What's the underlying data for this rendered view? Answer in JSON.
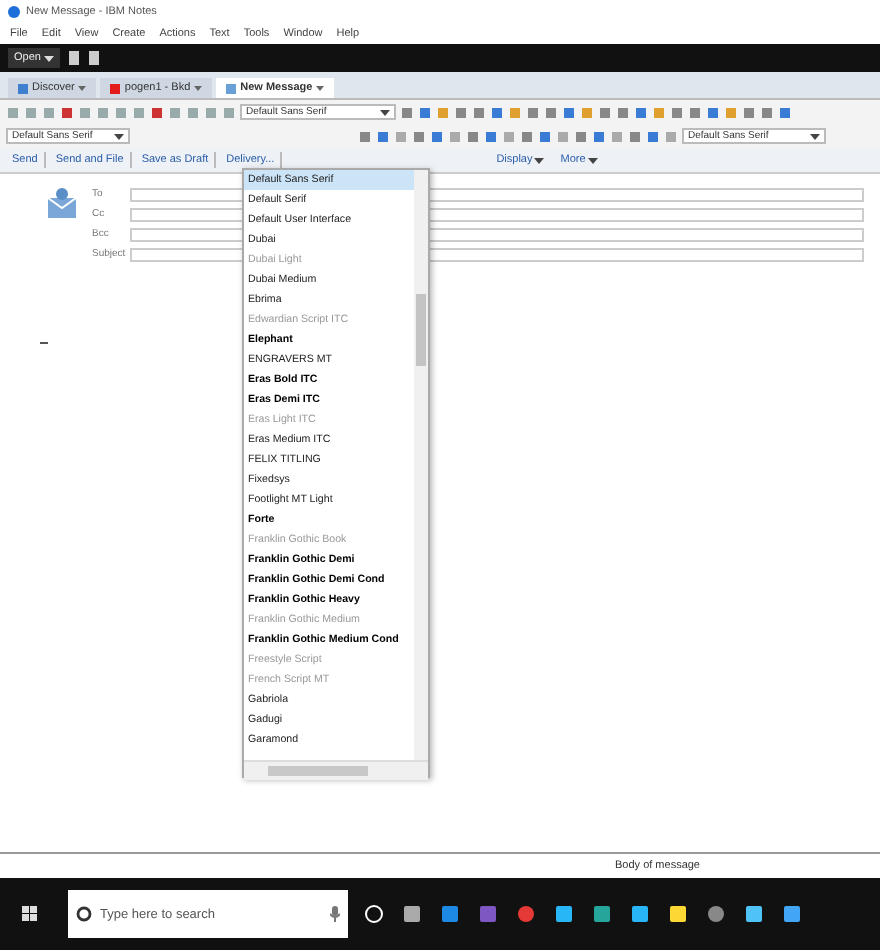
{
  "window": {
    "title": "New Message - IBM Notes"
  },
  "menu": [
    "File",
    "Edit",
    "View",
    "Create",
    "Actions",
    "Text",
    "Tools",
    "Window",
    "Help"
  ],
  "command_bar": {
    "open_button": "Open"
  },
  "tabs": [
    {
      "label": "Discover",
      "selected": false
    },
    {
      "label": "pogen1 - Bkd",
      "selected": false
    },
    {
      "label": "New Message",
      "selected": true
    }
  ],
  "toolbar": {
    "font_field": "Default Sans Serif"
  },
  "format_bar": {
    "font_field_left": "Default Sans Serif",
    "font_field_right": "Default Sans Serif"
  },
  "actions": [
    "Send",
    "Send and File",
    "Save as Draft",
    "Delivery..."
  ],
  "view_menus": [
    "Display",
    "More"
  ],
  "address_fields": [
    "To",
    "Cc",
    "Bcc",
    "Subject"
  ],
  "font_dropdown": {
    "items": [
      {
        "label": "Default Sans Serif",
        "kind": "normal",
        "selected": true
      },
      {
        "label": "Default Serif",
        "kind": "normal",
        "selected": false
      },
      {
        "label": "Default User Interface",
        "kind": "normal",
        "selected": false
      },
      {
        "label": "Dubai",
        "kind": "normal",
        "selected": false
      },
      {
        "label": "Dubai Light",
        "kind": "light",
        "selected": false
      },
      {
        "label": "Dubai Medium",
        "kind": "normal",
        "selected": false
      },
      {
        "label": "Ebrima",
        "kind": "normal",
        "selected": false
      },
      {
        "label": "Edwardian Script ITC",
        "kind": "light",
        "selected": false
      },
      {
        "label": "Elephant",
        "kind": "bold",
        "selected": false
      },
      {
        "label": "ENGRAVERS MT",
        "kind": "normal",
        "selected": false
      },
      {
        "label": "Eras Bold ITC",
        "kind": "bold",
        "selected": false
      },
      {
        "label": "Eras Demi ITC",
        "kind": "bold",
        "selected": false
      },
      {
        "label": "Eras Light ITC",
        "kind": "light",
        "selected": false
      },
      {
        "label": "Eras Medium ITC",
        "kind": "normal",
        "selected": false
      },
      {
        "label": "FELIX TITLING",
        "kind": "normal",
        "selected": false
      },
      {
        "label": "Fixedsys",
        "kind": "normal",
        "selected": false
      },
      {
        "label": "Footlight MT Light",
        "kind": "normal",
        "selected": false
      },
      {
        "label": "Forte",
        "kind": "bold",
        "selected": false
      },
      {
        "label": "Franklin Gothic Book",
        "kind": "light",
        "selected": false
      },
      {
        "label": "Franklin Gothic Demi",
        "kind": "bold",
        "selected": false
      },
      {
        "label": "Franklin Gothic Demi Cond",
        "kind": "bold",
        "selected": false
      },
      {
        "label": "Franklin Gothic Heavy",
        "kind": "bold",
        "selected": false
      },
      {
        "label": "Franklin Gothic Medium",
        "kind": "light",
        "selected": false
      },
      {
        "label": "Franklin Gothic Medium Cond",
        "kind": "bold",
        "selected": false
      },
      {
        "label": "Freestyle Script",
        "kind": "light",
        "selected": false
      },
      {
        "label": "French Script MT",
        "kind": "light",
        "selected": false
      },
      {
        "label": "Gabriola",
        "kind": "normal",
        "selected": false
      },
      {
        "label": "Gadugi",
        "kind": "normal",
        "selected": false
      },
      {
        "label": "Garamond",
        "kind": "normal",
        "selected": false
      }
    ]
  },
  "body_label": "Body of message",
  "taskbar": {
    "search": {
      "placeholder": "Type here to search"
    }
  }
}
